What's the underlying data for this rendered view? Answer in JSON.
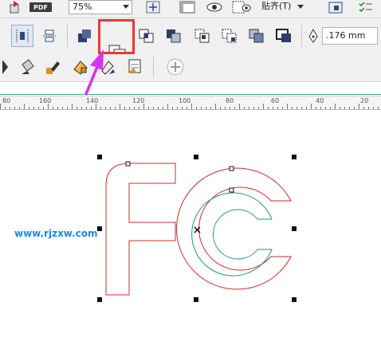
{
  "toolbar_top": {
    "zoom_value": "75%",
    "snap_label": "贴齐(T)",
    "pdf_label": "PDF"
  },
  "toolbar_property": {
    "outline_width": ".176 mm"
  },
  "ruler": {
    "labels": [
      "80",
      "160",
      "140",
      "120",
      "100",
      "80",
      "60",
      "40",
      "20"
    ]
  },
  "watermark": {
    "text": "www.rjzxw.com"
  },
  "colors": {
    "outer_shape_outline": "#d42a2a",
    "inner_shape_outline": "#1f9a63",
    "highlight_box": "#e53935",
    "arrow": "#d633f2",
    "ruler_accent": "#3fa6a6"
  }
}
